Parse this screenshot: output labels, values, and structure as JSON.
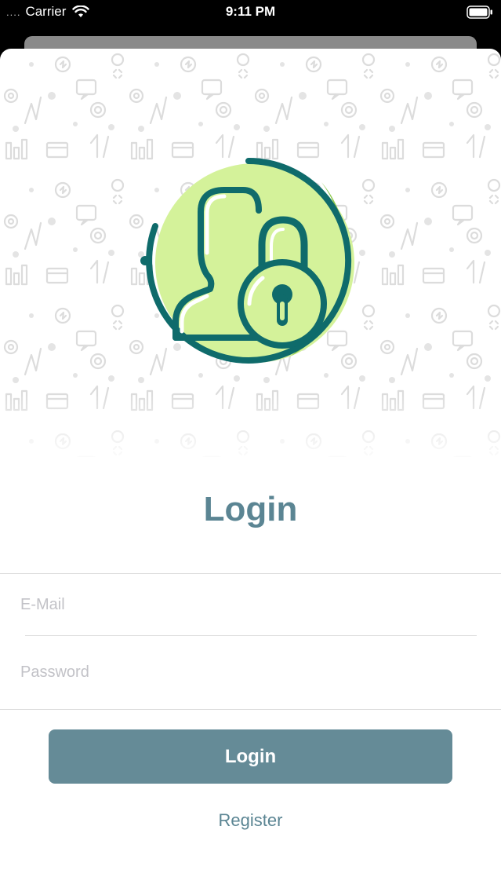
{
  "status_bar": {
    "signal": "....",
    "carrier": "Carrier",
    "time": "9:11 PM",
    "wifi_icon": "wifi-icon",
    "battery_icon": "battery-icon"
  },
  "header": {
    "illustration": "user-lock-icon",
    "title": "Login"
  },
  "form": {
    "email": {
      "value": "",
      "placeholder": "E-Mail"
    },
    "password": {
      "value": "",
      "placeholder": "Password"
    }
  },
  "actions": {
    "login_label": "Login",
    "register_label": "Register"
  },
  "colors": {
    "accent": "#5b8593",
    "button": "#658b97",
    "icon_stroke": "#0f6b6b",
    "icon_fill": "#d4f29a",
    "icon_shade": "#8cc84b"
  }
}
